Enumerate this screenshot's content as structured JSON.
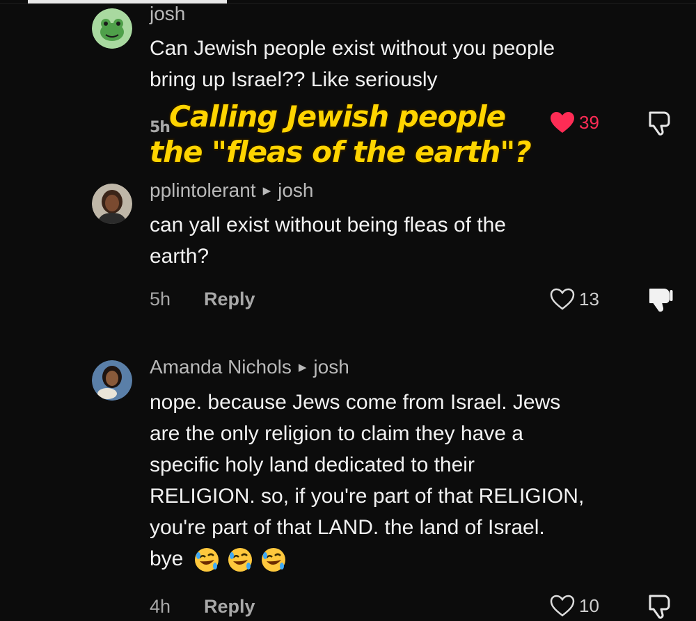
{
  "comments": [
    {
      "username": "josh",
      "text_lines": [
        "Can Jewish people exist without you people",
        "bring up Israel?? Like seriously"
      ],
      "time": "5h",
      "likes": "39",
      "liked": true,
      "avatar": "frog-avatar"
    },
    {
      "username": "pplintolerant",
      "reply_to": "josh",
      "text_lines": [
        "can yall exist without being fleas of the",
        "earth?"
      ],
      "time": "5h",
      "reply_label": "Reply",
      "likes": "13",
      "disliked": true,
      "avatar": "person-avatar"
    },
    {
      "username": "Amanda Nichols",
      "reply_to": "josh",
      "text_lines": [
        "nope. because Jews come from Israel. Jews",
        "are the only religion to claim they have a",
        "specific holy land dedicated to their",
        "RELIGION. so, if you're part of that RELIGION,",
        "you're part of that LAND. the land of Israel.",
        "bye"
      ],
      "emojis": [
        "rolling-on-floor-laughing",
        "rolling-on-floor-laughing",
        "rolling-on-floor-laughing"
      ],
      "time": "4h",
      "reply_label": "Reply",
      "likes": "10",
      "avatar": "person-avatar"
    }
  ],
  "overlay_caption": {
    "line1": "Calling Jewish people",
    "line2": "the \"fleas of the earth\"?"
  },
  "colors": {
    "background": "#0c0c0c",
    "caption": "#ffd400",
    "heart": "#fe2c55",
    "muted_text": "#a8a8a8"
  }
}
